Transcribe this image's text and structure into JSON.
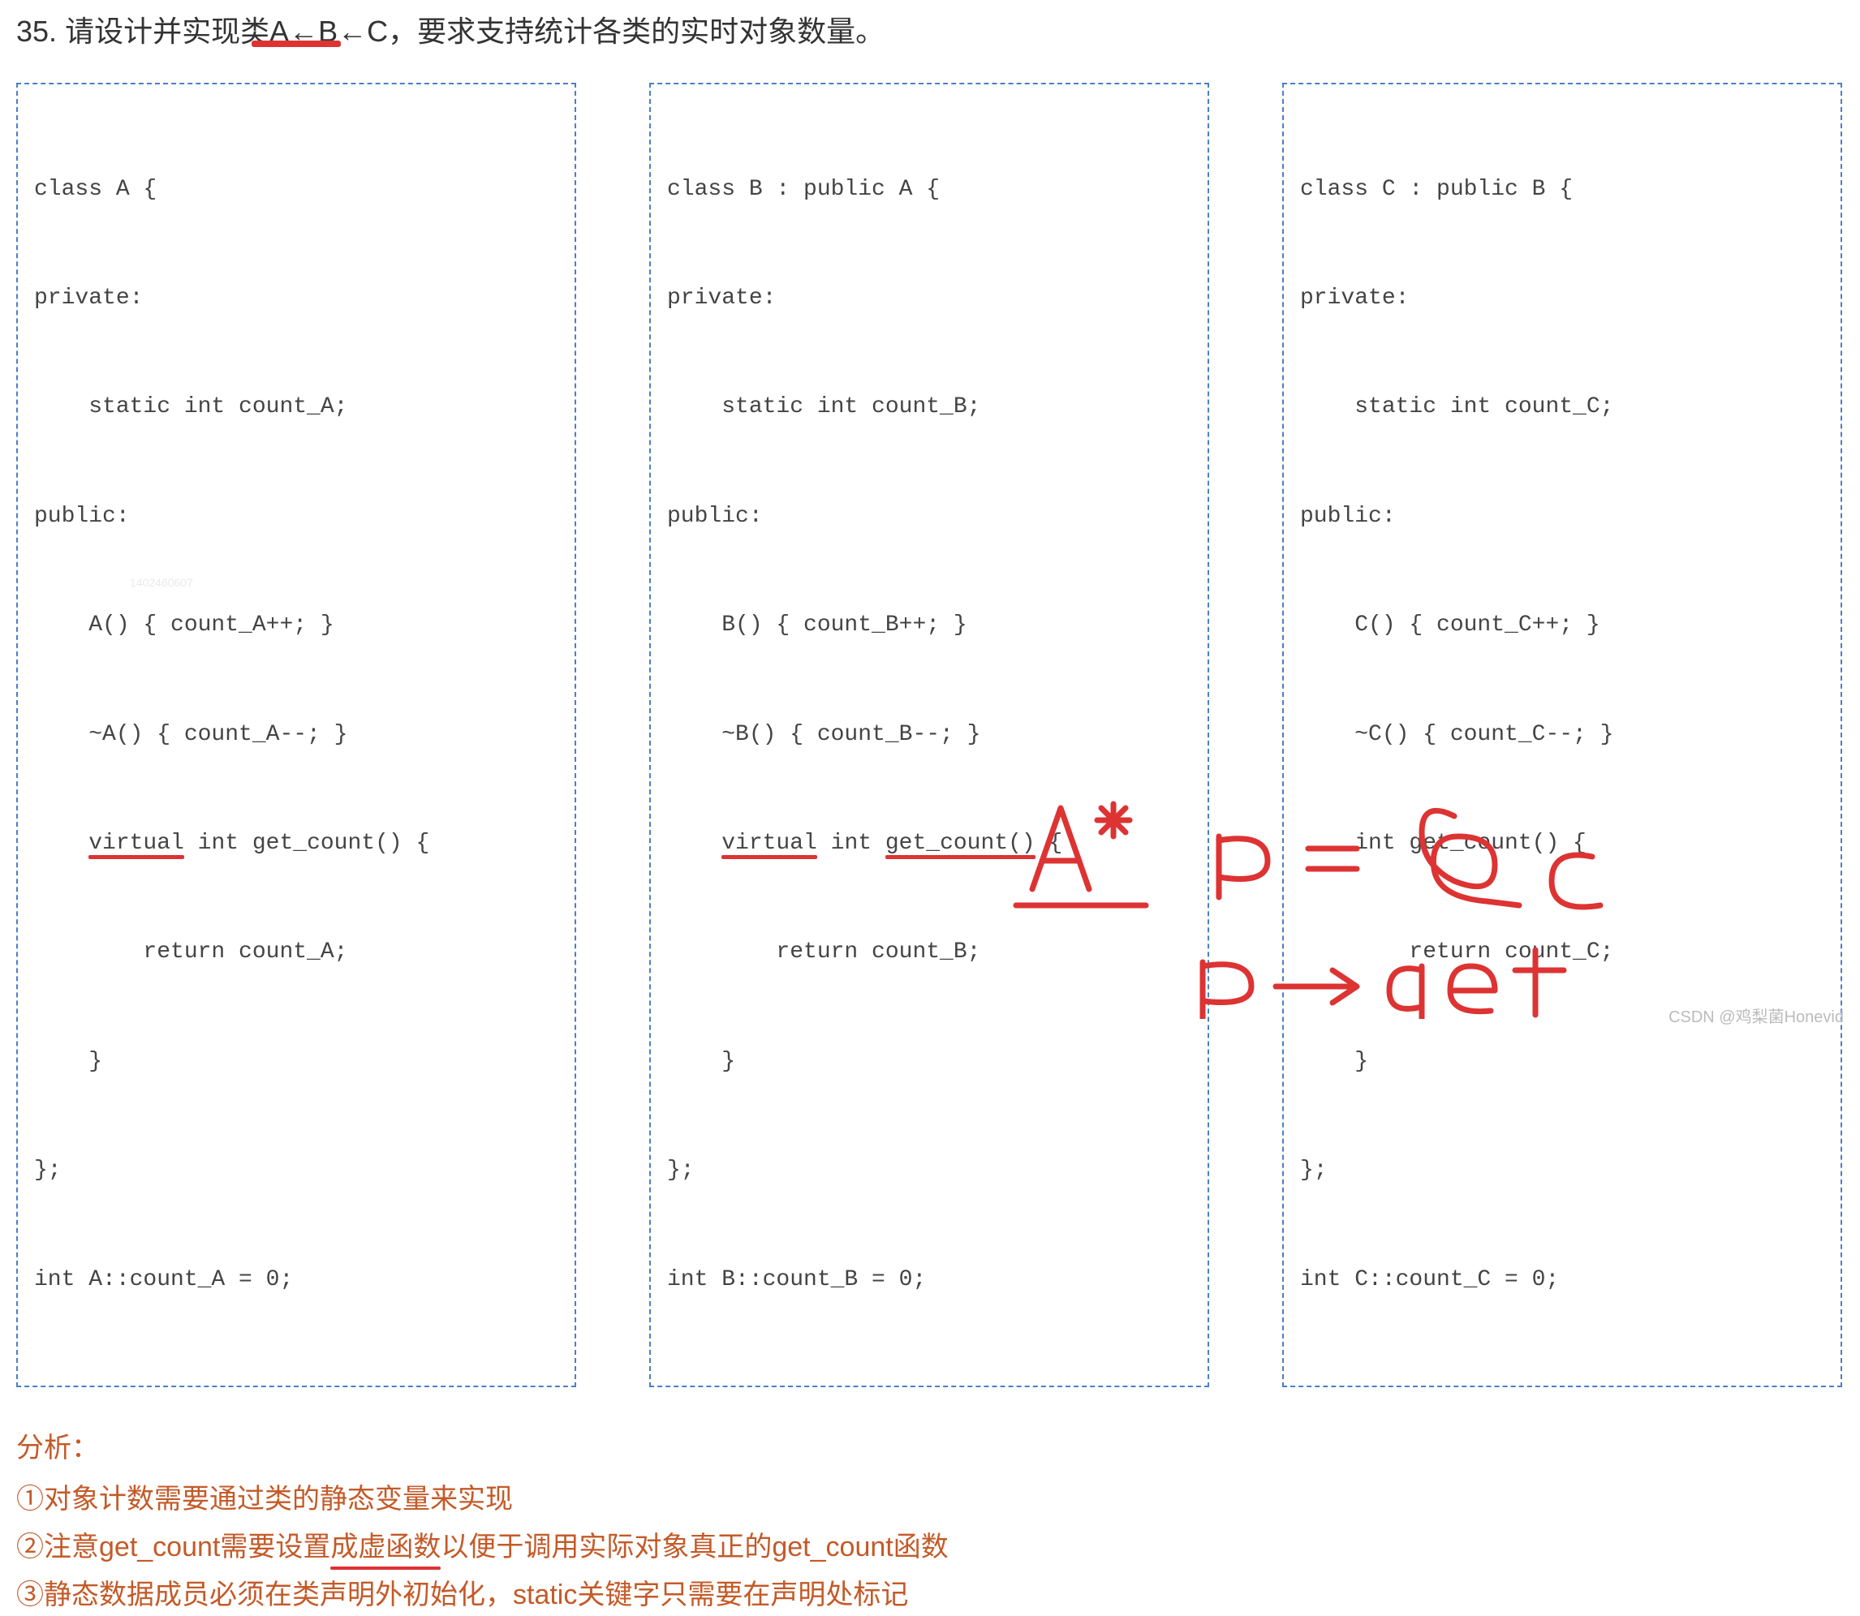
{
  "question": {
    "number": "35.",
    "text": "请设计并实现类A←B←C，要求支持统计各类的实时对象数量。"
  },
  "codeA": {
    "l1": "class A {",
    "l2": "private:",
    "l3": "    static int count_A;",
    "l4": "public:",
    "l5": "    A() { count_A++; }",
    "l6": "    ~A() { count_A--; }",
    "l7a": "    ",
    "l7_virtual": "virtual",
    "l7b": " int get_count() {",
    "l8": "        return count_A;",
    "l9": "    }",
    "l10": "};",
    "l11": "int A::count_A = 0;"
  },
  "codeB": {
    "l1": "class B : public A {",
    "l2": "private:",
    "l3": "    static int count_B;",
    "l4": "public:",
    "l5": "    B() { count_B++; }",
    "l6": "    ~B() { count_B--; }",
    "l7a": "    ",
    "l7_virtual": "virtual",
    "l7b": " int ",
    "l7_getcount": "get_count()",
    "l7c": " {",
    "l8": "        return count_B;",
    "l9": "    }",
    "l10": "};",
    "l11": "int B::count_B = 0;"
  },
  "codeC": {
    "l1": "class C : public B {",
    "l2": "private:",
    "l3": "    static int count_C;",
    "l4": "public:",
    "l5": "    C() { count_C++; }",
    "l6": "    ~C() { count_C--; }",
    "l7": "    int get_count() {",
    "l8": "        return count_C;",
    "l9": "    }",
    "l10": "};",
    "l11": "int C::count_C = 0;"
  },
  "analysis": {
    "title": "分析：",
    "item1": "①对象计数需要通过类的静态变量来实现",
    "item2_a": "②注意get_count需要设置",
    "item2_u": "成虚函数",
    "item2_b": "以便于调用实际对象真正的get_count函数",
    "item3": "③静态数据成员必须在类声明外初始化，static关键字只需要在声明处标记"
  },
  "watermarks": {
    "id": "1402460607",
    "csdn": "CSDN @鸡梨菌Honevid"
  },
  "handwriting": {
    "line1": "A*  p = &c",
    "line2": "p → get"
  }
}
